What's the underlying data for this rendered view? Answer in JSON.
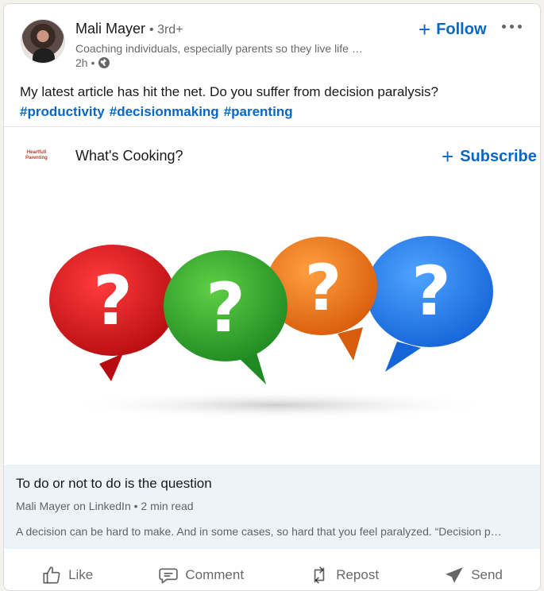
{
  "author": {
    "name": "Mali Mayer",
    "degree": "• 3rd+",
    "headline": "Coaching individuals, especially parents so they live life …",
    "time": "2h •"
  },
  "actions_top": {
    "follow_label": "Follow",
    "follow_icon": "+"
  },
  "post": {
    "text": "My latest article has hit the net. Do you suffer from decision paralysis?",
    "hashtags": [
      "#productivity",
      "#decisionmaking",
      "#parenting"
    ]
  },
  "newsletter": {
    "logo_text": "Heartfull Parenting",
    "title": "What's Cooking?",
    "subscribe_label": "Subscribe",
    "subscribe_icon": "+"
  },
  "article": {
    "bubble_symbol": "?",
    "bubble_colors": [
      "#d8161f",
      "#3aa82f",
      "#ee7a1a",
      "#2f7fe8"
    ],
    "title": "To do or not to do is the question",
    "byline": "Mali Mayer on LinkedIn • 2 min read",
    "snippet": "A decision can be hard to make. And in some cases, so hard that you feel paralyzed. “Decision p…"
  },
  "social_actions": {
    "like": "Like",
    "comment": "Comment",
    "repost": "Repost",
    "send": "Send"
  },
  "colors": {
    "accent": "#0a66c2",
    "article_bg": "#eef3f8"
  }
}
